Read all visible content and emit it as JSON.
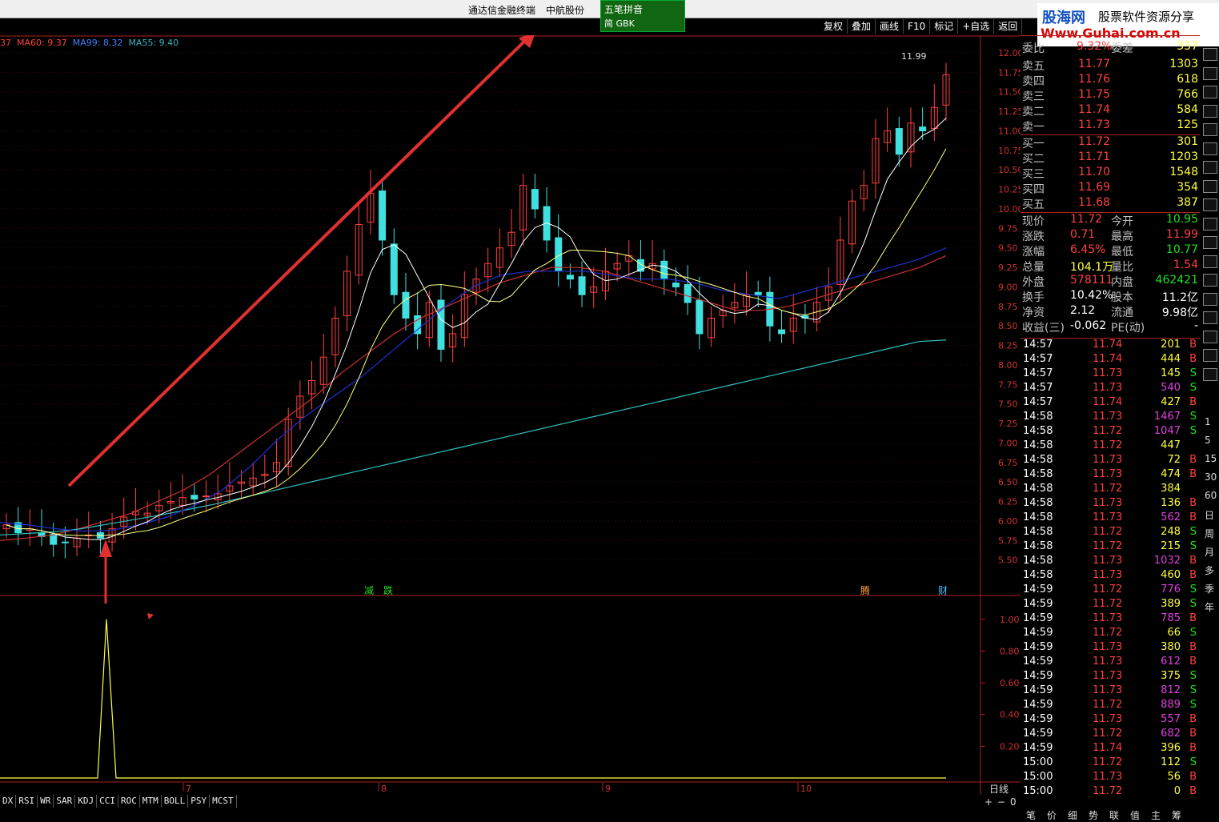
{
  "window": {
    "title": "通达信金融终端",
    "stock_name": "中航股份"
  },
  "ime": {
    "label": "五笔拼音",
    "mode": "简 GBK"
  },
  "logo": {
    "brand": "股海网",
    "tagline": "股票软件资源分享",
    "url": "Www.Guhai.com.cn"
  },
  "toolbar": {
    "items": [
      "复权",
      "叠加",
      "画线",
      "F10",
      "标记",
      "+自选",
      "返回"
    ]
  },
  "ma_legend": {
    "cut": "37",
    "ma60": "MA60: 9.37",
    "ma99": "MA99: 8.32",
    "ma55": "MA55: 9.40"
  },
  "chart_markers": {
    "jian": "减",
    "die": "跌",
    "teng": "腾",
    "cai": "财",
    "high": "11.99",
    "period": "日线"
  },
  "date_axis": [
    "7",
    "8",
    "9",
    "10"
  ],
  "chart_data": [
    {
      "type": "candlestick",
      "ylim": [
        5.25,
        12.0
      ],
      "y_ticks": [
        "12.00",
        "11.75",
        "11.50",
        "11.25",
        "11.00",
        "10.75",
        "10.50",
        "10.25",
        "10.00",
        "9.75",
        "9.50",
        "9.25",
        "9.00",
        "8.75",
        "8.50",
        "8.25",
        "8.00",
        "7.75",
        "7.50",
        "7.25",
        "7.00",
        "6.75",
        "6.50",
        "6.25",
        "6.00",
        "5.75",
        "5.50"
      ],
      "ma_series": [
        {
          "name": "MA60",
          "color": "#d03030",
          "values": [
            5.75,
            5.78,
            5.82,
            5.9,
            6.0,
            6.1,
            6.25,
            6.4,
            6.6,
            6.85,
            7.1,
            7.35,
            7.6,
            7.9,
            8.15,
            8.4,
            8.6,
            8.75,
            8.9,
            9.05,
            9.15,
            9.25,
            9.25,
            9.2,
            9.1,
            9.0,
            8.9,
            8.8,
            8.7,
            8.7,
            8.75,
            8.85,
            8.95,
            9.05,
            9.15,
            9.25,
            9.4
          ]
        },
        {
          "name": "MA99",
          "color": "#30c0c0",
          "values": [
            5.82,
            5.84,
            5.86,
            5.9,
            5.96,
            6.02,
            6.08,
            6.15,
            6.22,
            6.3,
            6.38,
            6.46,
            6.54,
            6.62,
            6.7,
            6.78,
            6.86,
            6.94,
            7.02,
            7.1,
            7.18,
            7.26,
            7.34,
            7.42,
            7.5,
            7.58,
            7.66,
            7.74,
            7.82,
            7.9,
            7.98,
            8.06,
            8.14,
            8.22,
            8.3,
            8.32
          ]
        },
        {
          "name": "MA55",
          "color": "#2030d0",
          "values": [
            5.98,
            5.95,
            5.9,
            5.87,
            5.88,
            5.95,
            6.05,
            6.2,
            6.4,
            6.7,
            7.05,
            7.35,
            7.6,
            7.85,
            8.15,
            8.45,
            8.75,
            9.0,
            9.15,
            9.2,
            9.2,
            9.2,
            9.15,
            9.1,
            9.1,
            9.05,
            8.95,
            8.9,
            8.85,
            8.95,
            9.05,
            9.15,
            9.25,
            9.35,
            9.5
          ]
        }
      ]
    },
    {
      "type": "line",
      "ylim": [
        0.0,
        1.1
      ],
      "y_ticks": [
        "1.00",
        "0.80",
        "0.60",
        "0.40",
        "0.20"
      ],
      "series": [
        {
          "values": [
            0,
            0,
            0,
            0,
            0,
            0,
            0,
            1.0,
            0,
            0,
            0,
            0,
            0,
            0,
            0,
            0,
            0,
            0,
            0,
            0,
            0,
            0,
            0,
            0,
            0,
            0,
            0,
            0,
            0,
            0,
            0,
            0,
            0,
            0,
            0,
            0
          ]
        }
      ]
    }
  ],
  "quote": {
    "webi": "委比",
    "webi_val": "9.32%",
    "wecha": "委差",
    "wecha_val": "337",
    "asks": [
      {
        "label": "卖五",
        "price": "11.77",
        "vol": "1303"
      },
      {
        "label": "卖四",
        "price": "11.76",
        "vol": "618"
      },
      {
        "label": "卖三",
        "price": "11.75",
        "vol": "766"
      },
      {
        "label": "卖二",
        "price": "11.74",
        "vol": "584"
      },
      {
        "label": "卖一",
        "price": "11.73",
        "vol": "125"
      }
    ],
    "bids": [
      {
        "label": "买一",
        "price": "11.72",
        "vol": "301"
      },
      {
        "label": "买二",
        "price": "11.71",
        "vol": "1203"
      },
      {
        "label": "买三",
        "price": "11.70",
        "vol": "1548"
      },
      {
        "label": "买四",
        "price": "11.69",
        "vol": "354"
      },
      {
        "label": "买五",
        "price": "11.68",
        "vol": "387"
      }
    ],
    "stats": [
      {
        "l1": "现价",
        "v1": "11.72",
        "l2": "今开",
        "v2": "10.95",
        "c1": "#ff4040",
        "c2": "#20e020"
      },
      {
        "l1": "涨跌",
        "v1": "0.71",
        "l2": "最高",
        "v2": "11.99",
        "c1": "#ff4040",
        "c2": "#ff4040"
      },
      {
        "l1": "涨幅",
        "v1": "6.45%",
        "l2": "最低",
        "v2": "10.77",
        "c1": "#ff4040",
        "c2": "#20e020"
      },
      {
        "l1": "总量",
        "v1": "104.1万",
        "l2": "量比",
        "v2": "1.54",
        "c1": "#ffff40",
        "c2": "#ff4040"
      },
      {
        "l1": "外盘",
        "v1": "578111",
        "l2": "内盘",
        "v2": "462421",
        "c1": "#ff4040",
        "c2": "#20e020"
      },
      {
        "l1": "换手",
        "v1": "10.42%",
        "l2": "股本",
        "v2": "11.2亿",
        "c1": "#ffffff",
        "c2": "#ffffff"
      },
      {
        "l1": "净资",
        "v1": "2.12",
        "l2": "流通",
        "v2": "9.98亿",
        "c1": "#ffffff",
        "c2": "#ffffff"
      },
      {
        "l1": "收益(三)",
        "v1": "-0.062",
        "l2": "PE(动)",
        "v2": "-",
        "c1": "#ffffff",
        "c2": "#ffffff"
      }
    ],
    "ticks": [
      {
        "t": "14:57",
        "p": "11.74",
        "v": "201",
        "s": "B",
        "vc": "#ffff40"
      },
      {
        "t": "14:57",
        "p": "11.74",
        "v": "444",
        "s": "B",
        "vc": "#ffff40"
      },
      {
        "t": "14:57",
        "p": "11.73",
        "v": "145",
        "s": "S",
        "vc": "#ffff40"
      },
      {
        "t": "14:57",
        "p": "11.73",
        "v": "540",
        "s": "S",
        "vc": "#e040e0"
      },
      {
        "t": "14:57",
        "p": "11.74",
        "v": "427",
        "s": "B",
        "vc": "#ffff40"
      },
      {
        "t": "14:58",
        "p": "11.73",
        "v": "1467",
        "s": "S",
        "vc": "#e040e0"
      },
      {
        "t": "14:58",
        "p": "11.72",
        "v": "1047",
        "s": "S",
        "vc": "#e040e0"
      },
      {
        "t": "14:58",
        "p": "11.72",
        "v": "447",
        "s": "",
        "vc": "#ffff40"
      },
      {
        "t": "14:58",
        "p": "11.73",
        "v": "72",
        "s": "B",
        "vc": "#ffff40"
      },
      {
        "t": "14:58",
        "p": "11.73",
        "v": "474",
        "s": "B",
        "vc": "#ffff40"
      },
      {
        "t": "14:58",
        "p": "11.72",
        "v": "384",
        "s": "",
        "vc": "#ffff40"
      },
      {
        "t": "14:58",
        "p": "11.73",
        "v": "136",
        "s": "B",
        "vc": "#ffff40"
      },
      {
        "t": "14:58",
        "p": "11.73",
        "v": "562",
        "s": "B",
        "vc": "#e040e0"
      },
      {
        "t": "14:58",
        "p": "11.72",
        "v": "248",
        "s": "S",
        "vc": "#ffff40"
      },
      {
        "t": "14:58",
        "p": "11.72",
        "v": "215",
        "s": "S",
        "vc": "#ffff40"
      },
      {
        "t": "14:58",
        "p": "11.73",
        "v": "1032",
        "s": "B",
        "vc": "#e040e0"
      },
      {
        "t": "14:58",
        "p": "11.73",
        "v": "460",
        "s": "B",
        "vc": "#ffff40"
      },
      {
        "t": "14:59",
        "p": "11.72",
        "v": "776",
        "s": "S",
        "vc": "#e040e0"
      },
      {
        "t": "14:59",
        "p": "11.72",
        "v": "389",
        "s": "S",
        "vc": "#ffff40"
      },
      {
        "t": "14:59",
        "p": "11.73",
        "v": "785",
        "s": "B",
        "vc": "#e040e0"
      },
      {
        "t": "14:59",
        "p": "11.72",
        "v": "66",
        "s": "S",
        "vc": "#ffff40"
      },
      {
        "t": "14:59",
        "p": "11.73",
        "v": "380",
        "s": "B",
        "vc": "#ffff40"
      },
      {
        "t": "14:59",
        "p": "11.73",
        "v": "612",
        "s": "B",
        "vc": "#e040e0"
      },
      {
        "t": "14:59",
        "p": "11.73",
        "v": "375",
        "s": "S",
        "vc": "#ffff40"
      },
      {
        "t": "14:59",
        "p": "11.73",
        "v": "812",
        "s": "S",
        "vc": "#e040e0"
      },
      {
        "t": "14:59",
        "p": "11.72",
        "v": "889",
        "s": "S",
        "vc": "#e040e0"
      },
      {
        "t": "14:59",
        "p": "11.73",
        "v": "557",
        "s": "B",
        "vc": "#e040e0"
      },
      {
        "t": "14:59",
        "p": "11.72",
        "v": "682",
        "s": "B",
        "vc": "#e040e0"
      },
      {
        "t": "14:59",
        "p": "11.74",
        "v": "396",
        "s": "B",
        "vc": "#ffff40"
      },
      {
        "t": "15:00",
        "p": "11.72",
        "v": "112",
        "s": "S",
        "vc": "#ffff40"
      },
      {
        "t": "15:00",
        "p": "11.73",
        "v": "56",
        "s": "B",
        "vc": "#ffff40"
      },
      {
        "t": "15:00",
        "p": "11.72",
        "v": "0",
        "s": "B",
        "vc": "#ffff40"
      }
    ]
  },
  "indicator_tabs": [
    "DX",
    "RSI",
    "WR",
    "SAR",
    "KDJ",
    "CCI",
    "ROC",
    "MTM",
    "BOLL",
    "PSY",
    "MCST"
  ],
  "zoom": {
    "plus": "+",
    "minus": "−",
    "value": "0"
  },
  "bottom_tabs": [
    "笔",
    "价",
    "细",
    "势",
    "联",
    "值",
    "主",
    "筹"
  ],
  "side_periods": [
    "1",
    "5",
    "15",
    "30",
    "60",
    "日",
    "周",
    "月",
    "多",
    "季",
    "年"
  ]
}
